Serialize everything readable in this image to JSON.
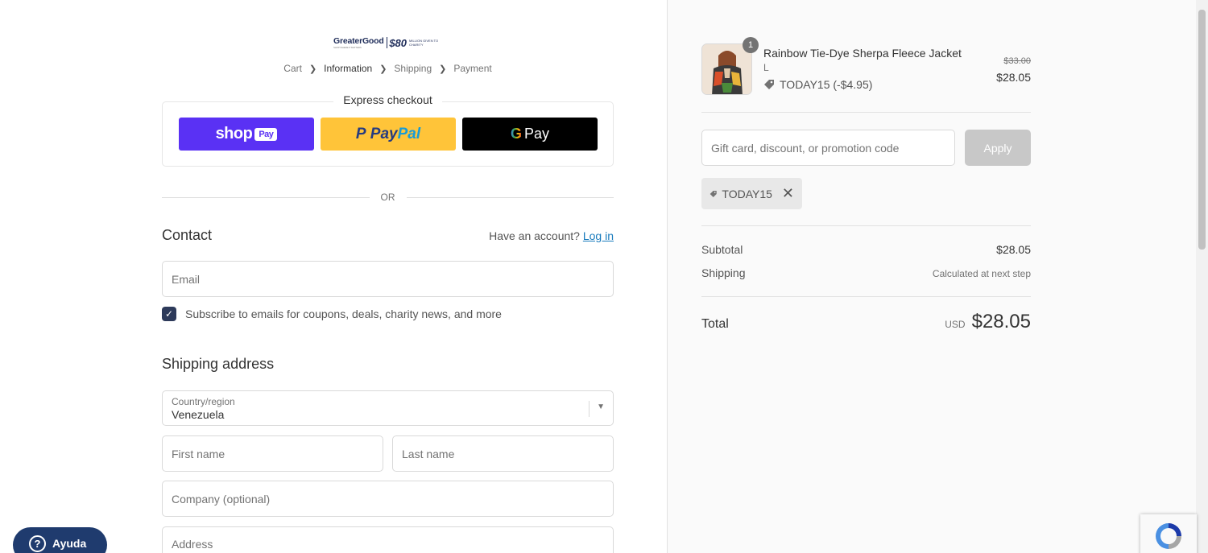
{
  "brand": {
    "name": "GreaterGood",
    "tagline": "SHOP WHERE IT MATTERS",
    "badge_num": "$80",
    "badge_text": "MILLION GIVEN TO CHARITY"
  },
  "breadcrumb": [
    "Cart",
    "Information",
    "Shipping",
    "Payment"
  ],
  "express": {
    "title": "Express checkout",
    "shop_label": "shop",
    "shop_pay": "Pay",
    "paypal_1": "Pay",
    "paypal_2": "Pal",
    "gpay_label": "Pay"
  },
  "or_label": "OR",
  "contact": {
    "heading": "Contact",
    "account_prompt": "Have an account?",
    "login_label": "Log in",
    "email_placeholder": "Email",
    "subscribe_label": "Subscribe to emails for coupons, deals, charity news, and more",
    "subscribe_checked": true
  },
  "shipping": {
    "heading": "Shipping address",
    "country_label": "Country/region",
    "country_value": "Venezuela",
    "first_name_placeholder": "First name",
    "last_name_placeholder": "Last name",
    "company_placeholder": "Company (optional)",
    "address_placeholder": "Address"
  },
  "help_label": "Ayuda",
  "summary": {
    "product": {
      "name": "Rainbow Tie-Dye Sherpa Fleece Jacket",
      "variant": "L",
      "quantity": "1",
      "discount": "TODAY15 (-$4.95)",
      "old_price": "$33.00",
      "price": "$28.05"
    },
    "code_placeholder": "Gift card, discount, or promotion code",
    "apply_label": "Apply",
    "applied_code": "TODAY15",
    "subtotal_label": "Subtotal",
    "subtotal_value": "$28.05",
    "shipping_label": "Shipping",
    "shipping_value": "Calculated at next step",
    "total_label": "Total",
    "total_currency": "USD",
    "total_value": "$28.05"
  }
}
